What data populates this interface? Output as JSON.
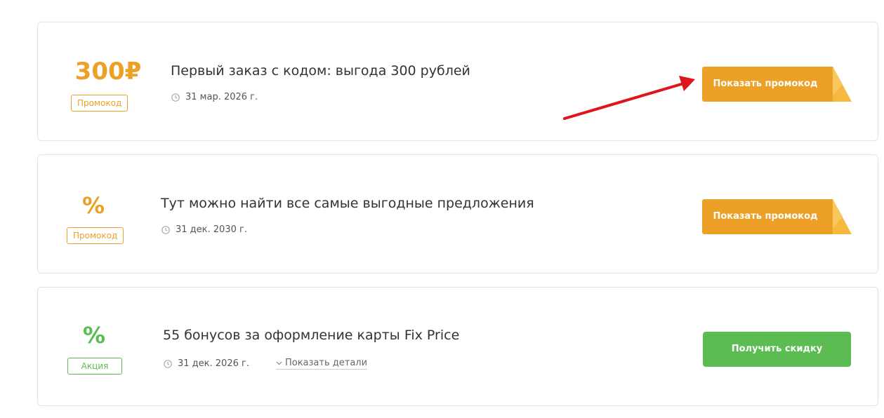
{
  "offers": [
    {
      "value": "300₽",
      "badge": "Промокод",
      "title": "Первый заказ с кодом: выгода 300 рублей",
      "date": "31 мар. 2026 г.",
      "button_label": "Показать промокод"
    },
    {
      "value": "%",
      "badge": "Промокод",
      "title": "Тут можно найти все самые выгодные предложения",
      "date": "31 дек. 2030 г.",
      "button_label": "Показать промокод"
    },
    {
      "value": "%",
      "badge": "Акция",
      "title": "55 бонусов за оформление карты Fix Price",
      "date": "31 дек. 2026 г.",
      "details_label": "Показать детали",
      "button_label": "Получить скидку"
    }
  ],
  "colors": {
    "promo_accent": "#eca126",
    "deal_accent": "#5bbc51",
    "annotation_arrow": "#e0141b"
  },
  "icons": [
    "clock-icon",
    "chevron-down-icon",
    "annotation-arrow"
  ]
}
